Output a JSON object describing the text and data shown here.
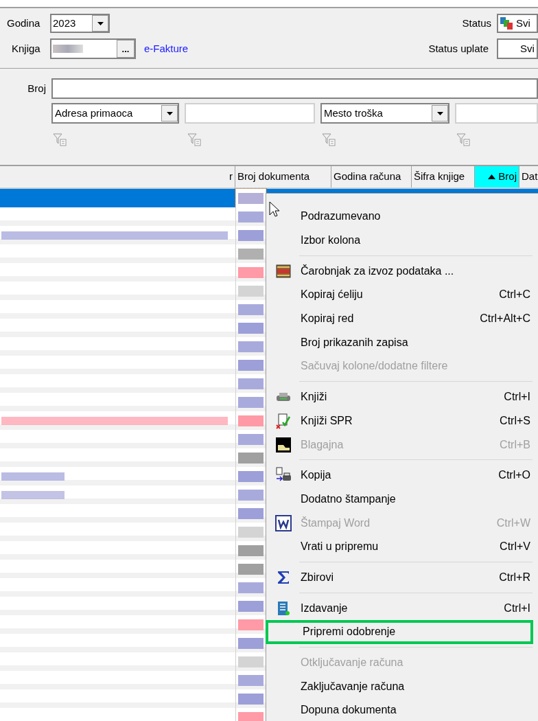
{
  "header": {
    "year_label": "Godina",
    "year_value": "2023",
    "book_label": "Knjiga",
    "book_button": "...",
    "link": "e-Fakture",
    "status_label": "Status",
    "status_value": "Svi",
    "payment_label": "Status uplate",
    "payment_value": "Svi"
  },
  "filters": {
    "number_label": "Broj",
    "select_1": "Adresa primaoca",
    "select_2": "Mesto troška"
  },
  "table": {
    "columns": [
      {
        "label": "r",
        "sorted": false
      },
      {
        "label": "Broj dokumenta",
        "sorted": false
      },
      {
        "label": "Godina računa",
        "sorted": false
      },
      {
        "label": "Šifra knjige",
        "sorted": false
      },
      {
        "label": "Broj",
        "sorted": true
      },
      {
        "label": "Dat",
        "sorted": false
      }
    ],
    "rows": [
      {
        "selected": true,
        "color": "#b4b0d8",
        "kind": "plain"
      },
      {
        "selected": false,
        "color": "#a9aadc",
        "kind": "plain"
      },
      {
        "selected": false,
        "color": "#9d9fd8",
        "kind": "wide"
      },
      {
        "selected": false,
        "color": "#b0b0b0",
        "kind": "plain"
      },
      {
        "selected": false,
        "color": "#ff9aa6",
        "kind": "plain"
      },
      {
        "selected": false,
        "color": "#d4d4d4",
        "kind": "plain"
      },
      {
        "selected": false,
        "color": "#a9aadc",
        "kind": "plain"
      },
      {
        "selected": false,
        "color": "#9d9fd8",
        "kind": "plain"
      },
      {
        "selected": false,
        "color": "#a9aadc",
        "kind": "plain"
      },
      {
        "selected": false,
        "color": "#9d9fd8",
        "kind": "plain"
      },
      {
        "selected": false,
        "color": "#a9aadc",
        "kind": "plain"
      },
      {
        "selected": false,
        "color": "#a9aadc",
        "kind": "plain"
      },
      {
        "selected": false,
        "color": "#ff9aa6",
        "kind": "wide"
      },
      {
        "selected": false,
        "color": "#a9aadc",
        "kind": "plain"
      },
      {
        "selected": false,
        "color": "#a0a0a0",
        "kind": "plain"
      },
      {
        "selected": false,
        "color": "#9d9fd8",
        "kind": "short"
      },
      {
        "selected": false,
        "color": "#a9aadc",
        "kind": "short"
      },
      {
        "selected": false,
        "color": "#9d9fd8",
        "kind": "plain"
      },
      {
        "selected": false,
        "color": "#d4d4d4",
        "kind": "plain"
      },
      {
        "selected": false,
        "color": "#a0a0a0",
        "kind": "plain"
      },
      {
        "selected": false,
        "color": "#a0a0a0",
        "kind": "plain"
      },
      {
        "selected": false,
        "color": "#a9aadc",
        "kind": "plain"
      },
      {
        "selected": false,
        "color": "#9d9fd8",
        "kind": "plain"
      },
      {
        "selected": false,
        "color": "#ff9aa6",
        "kind": "plain"
      },
      {
        "selected": false,
        "color": "#9d9fd8",
        "kind": "plain"
      },
      {
        "selected": false,
        "color": "#d4d4d4",
        "kind": "plain"
      },
      {
        "selected": false,
        "color": "#a9aadc",
        "kind": "plain"
      },
      {
        "selected": false,
        "color": "#9d9fd8",
        "kind": "plain"
      },
      {
        "selected": false,
        "color": "#ff9aa6",
        "kind": "plain"
      }
    ]
  },
  "context_menu": [
    {
      "kind": "item",
      "label": "Podrazumevano",
      "disabled": false,
      "highlighted": false
    },
    {
      "kind": "item",
      "label": "Izbor kolona",
      "disabled": false,
      "highlighted": false
    },
    {
      "kind": "separator"
    },
    {
      "kind": "item",
      "label": "Čarobnjak za izvoz podataka ...",
      "disabled": false,
      "highlighted": false
    },
    {
      "kind": "item",
      "label": "Kopiraj ćeliju",
      "shortcut": "Ctrl+C",
      "disabled": false,
      "highlighted": false
    },
    {
      "kind": "item",
      "label": "Kopiraj red",
      "shortcut": "Ctrl+Alt+C",
      "disabled": false,
      "highlighted": false
    },
    {
      "kind": "item",
      "label": "Broj prikazanih zapisa",
      "disabled": false,
      "highlighted": false
    },
    {
      "kind": "item",
      "label": "Sačuvaj kolone/dodatne filtere",
      "disabled": true,
      "highlighted": false
    },
    {
      "kind": "separator"
    },
    {
      "kind": "item",
      "label": "Knjiži",
      "shortcut": "Ctrl+I",
      "disabled": false,
      "highlighted": false
    },
    {
      "kind": "item",
      "label": "Knjiži SPR",
      "shortcut": "Ctrl+S",
      "disabled": false,
      "highlighted": false
    },
    {
      "kind": "item",
      "label": "Blagajna",
      "shortcut": "Ctrl+B",
      "disabled": true,
      "highlighted": false
    },
    {
      "kind": "separator"
    },
    {
      "kind": "item",
      "label": "Kopija",
      "shortcut": "Ctrl+O",
      "disabled": false,
      "highlighted": false
    },
    {
      "kind": "item",
      "label": "Dodatno štampanje",
      "disabled": false,
      "highlighted": false
    },
    {
      "kind": "item",
      "label": "Štampaj Word",
      "shortcut": "Ctrl+W",
      "disabled": true,
      "highlighted": false
    },
    {
      "kind": "item",
      "label": "Vrati u pripremu",
      "shortcut": "Ctrl+V",
      "disabled": false,
      "highlighted": false
    },
    {
      "kind": "separator"
    },
    {
      "kind": "item",
      "label": "Zbirovi",
      "shortcut": "Ctrl+R",
      "disabled": false,
      "highlighted": false
    },
    {
      "kind": "separator"
    },
    {
      "kind": "item",
      "label": "Izdavanje",
      "shortcut": "Ctrl+I",
      "disabled": false,
      "highlighted": false
    },
    {
      "kind": "item",
      "label": "Pripremi odobrenje",
      "disabled": false,
      "highlighted": true
    },
    {
      "kind": "separator"
    },
    {
      "kind": "item",
      "label": "Otključavanje računa",
      "disabled": true,
      "highlighted": false
    },
    {
      "kind": "item",
      "label": "Zaključavanje računa",
      "disabled": false,
      "highlighted": false
    },
    {
      "kind": "item",
      "label": "Dopuna dokumenta",
      "disabled": false,
      "highlighted": false
    }
  ]
}
